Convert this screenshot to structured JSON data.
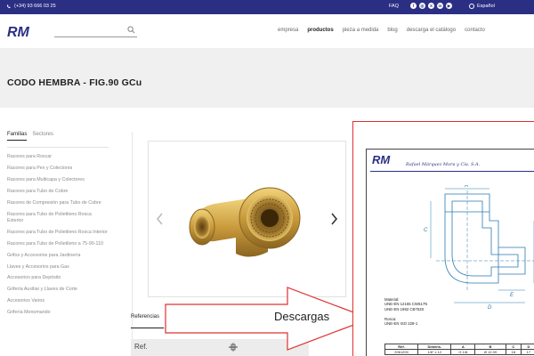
{
  "topbar": {
    "phone": "(+34) 93 666 03 25",
    "faq": "FAQ",
    "language": "Español",
    "social_icons": [
      "facebook-icon",
      "instagram-icon",
      "x-icon",
      "linkedin-icon",
      "youtube-icon"
    ]
  },
  "brand": {
    "logo_text": "RM",
    "color": "#2b2f84"
  },
  "search": {
    "placeholder": "",
    "value": ""
  },
  "nav": {
    "items": [
      "empresa",
      "productos",
      "pieza a medida",
      "blog",
      "descarga el catálogo",
      "contacto"
    ],
    "active": "productos"
  },
  "page": {
    "title": "CODO HEMBRA - FIG.90 GCu"
  },
  "sidebar": {
    "tabs": [
      "Familias",
      "Sectores"
    ],
    "active_tab": "Familias",
    "categories": [
      "Racores para Roscar",
      "Racores para Pex y Colectores",
      "Racores para Multicapa y Colectores",
      "Racores para Tubo de Cobre",
      "Racores de Compresión para Tubo de Cobre",
      "Racores para Tubo de Polietileno Rosca Exterior",
      "Racores para Tubo de Polietileno Rosca Interior",
      "Racores para Tubo de Polietileno a 75-90-110",
      "Grifos y Accesorios para Jardinería",
      "Llaves y Accesorios para Gas",
      "Accesorios para Depósito",
      "Grifería Auxiliar y Llaves de Corte",
      "Accesorios Varios",
      "Grifería Monomando"
    ]
  },
  "product_tabs": {
    "active": "Referencias"
  },
  "ref_table": {
    "header_ref": "Ref."
  },
  "annotation": {
    "label": "Descargas",
    "color": "#e03030"
  },
  "pdf": {
    "company": "Rafael Márquez Mora y Cía. S.A.",
    "dim_labels": [
      "A",
      "B",
      "C",
      "D",
      "E"
    ],
    "material_lines": [
      "Material:",
      "UNE-EN 12165 CW617N",
      "UNE-EN 1982 CB753S",
      "",
      "Rosca:",
      "UNE-EN ISO 228-1"
    ],
    "table_header": [
      "Ref.",
      "Dimens.",
      "A",
      "B",
      "C",
      "D",
      ""
    ],
    "table_rows": [
      [
        "2061200",
        "1/8\" x 12",
        "G 1/8",
        "Ø 12.09",
        "18",
        "17",
        ""
      ]
    ]
  }
}
